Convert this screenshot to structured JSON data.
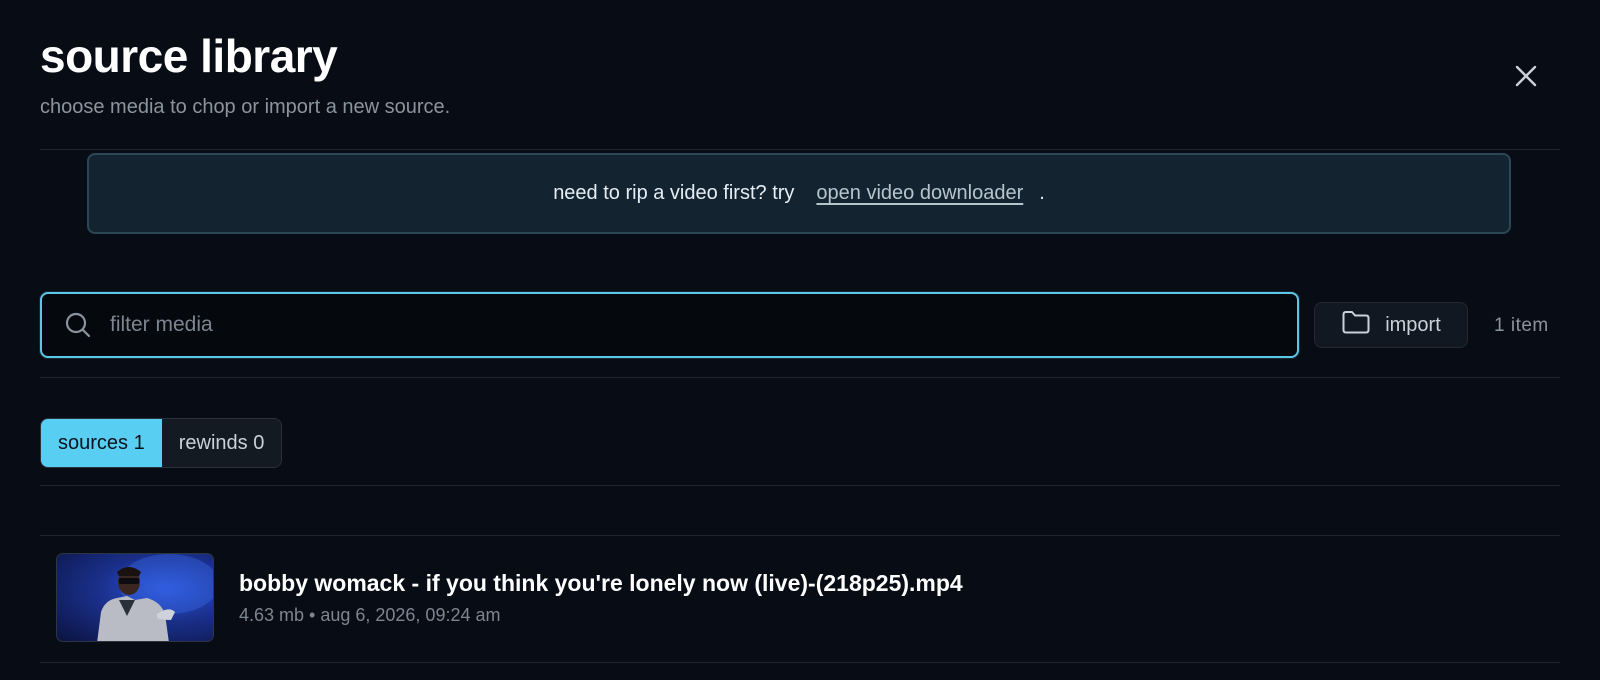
{
  "header": {
    "title": "source library",
    "subtitle": "choose media to chop or import a new source."
  },
  "notice": {
    "text": "need to rip a video first? try",
    "link_label": "open video downloader",
    "suffix": "."
  },
  "search": {
    "placeholder": "filter media",
    "value": ""
  },
  "import_button": {
    "label": "import",
    "icon": "folder-icon"
  },
  "item_count": "1 item",
  "tabs": [
    {
      "label": "sources 1",
      "active": true
    },
    {
      "label": "rewinds 0",
      "active": false
    }
  ],
  "media": [
    {
      "title": "bobby womack - if you think you're lonely now (live)-(218p25).mp4",
      "meta": "4.63 mb • aug 6, 2026, 09:24 am"
    }
  ],
  "colors": {
    "background": "#080d15",
    "accent": "#58cff2",
    "notice_bg": "#132430",
    "search_border": "#5cc6e6"
  }
}
